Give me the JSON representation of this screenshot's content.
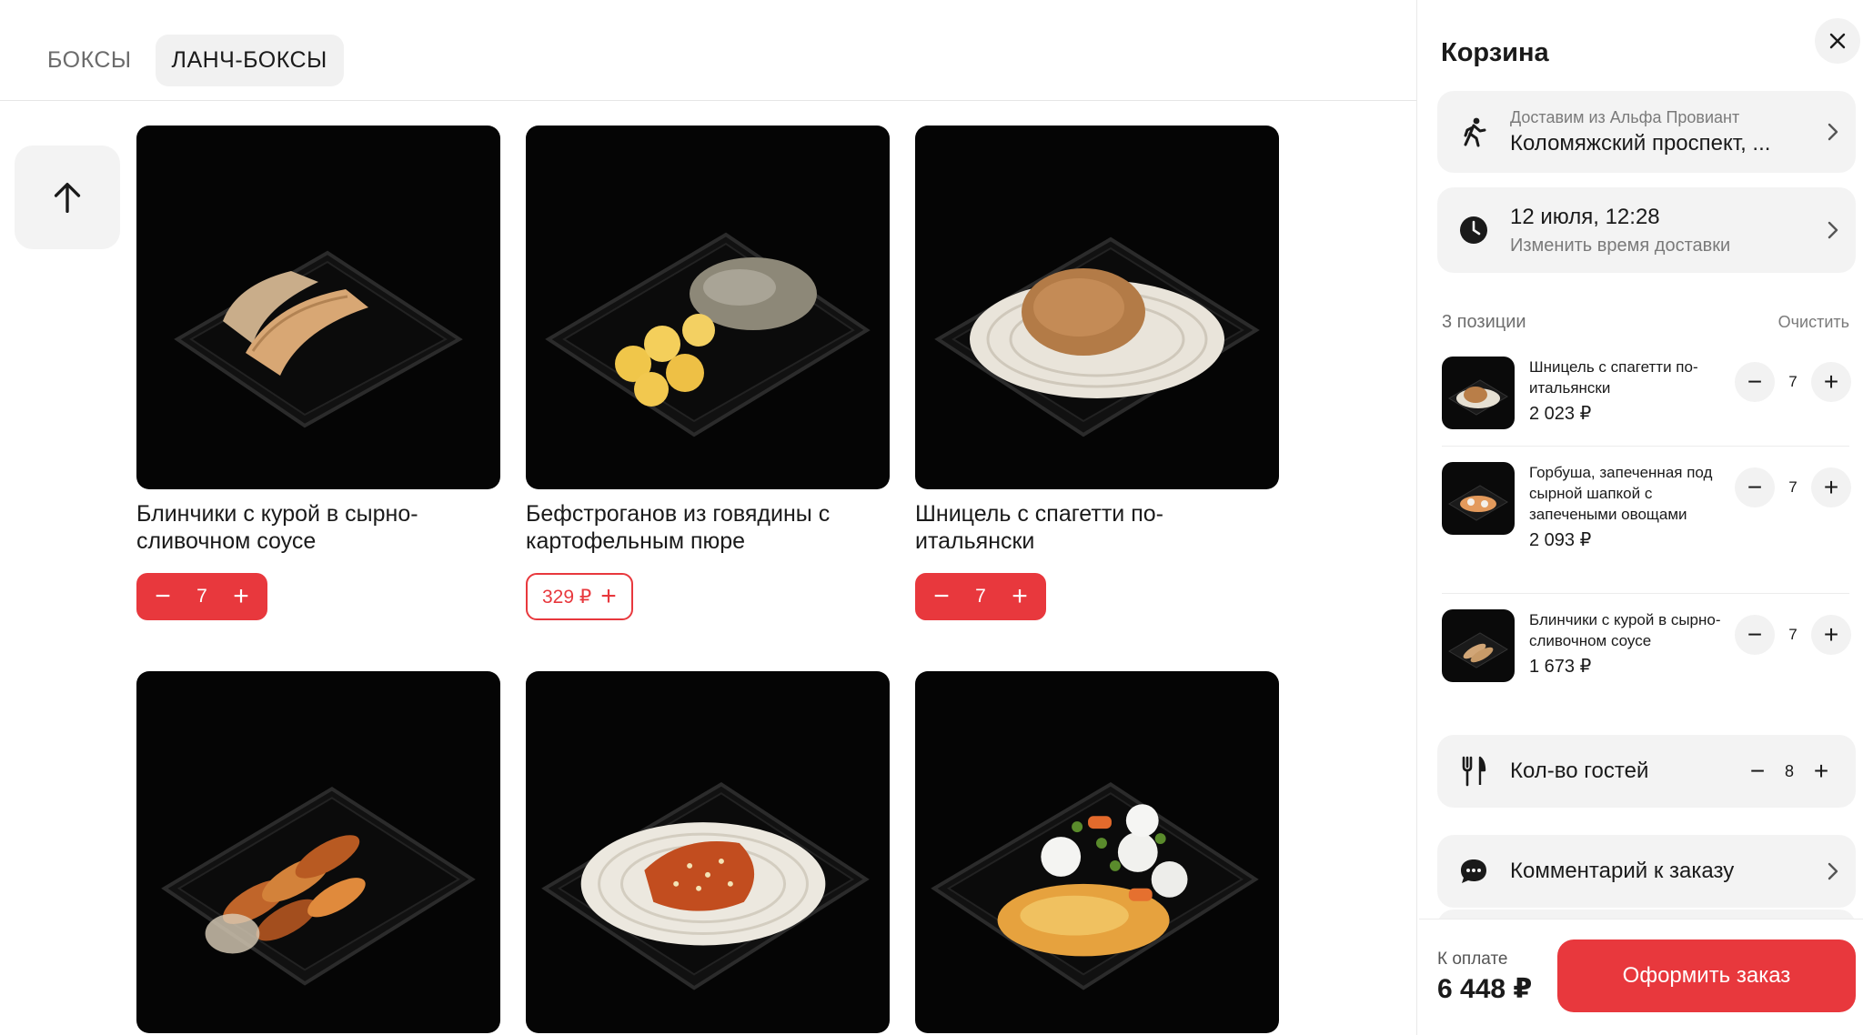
{
  "tabs": [
    {
      "label": "БОКСЫ",
      "active": false
    },
    {
      "label": "ЛАНЧ-БОКСЫ",
      "active": true
    }
  ],
  "products": [
    {
      "name": "Блинчики с курой в сырно-сливочном соусе",
      "qty": "7",
      "food": "crepes"
    },
    {
      "name": "Бефстроганов из говядины с картофельным пюре",
      "price": "329 ₽",
      "food": "stroganoff"
    },
    {
      "name": "Шницель с спагетти по-итальянски",
      "qty": "7",
      "food": "schnitzel"
    },
    {
      "name": "",
      "food": "potatoes"
    },
    {
      "name": "",
      "food": "noodles"
    },
    {
      "name": "",
      "food": "vegetables"
    }
  ],
  "cart": {
    "title": "Корзина",
    "delivery": {
      "label": "Доставим из Альфа Провиант",
      "address": "Коломяжский проспект, ..."
    },
    "time": {
      "value": "12 июля, 12:28",
      "change_label": "Изменить время доставки"
    },
    "positions_label": "3 позиции",
    "clear_label": "Очистить",
    "items": [
      {
        "name": "Шницель с спагетти по-итальянски",
        "price": "2 023 ₽",
        "qty": "7"
      },
      {
        "name": "Горбуша, запеченная под сырной шапкой с запечеными овощами",
        "price": "2 093 ₽",
        "qty": "7"
      },
      {
        "name": "Блинчики с курой в сырно-сливочном соусе",
        "price": "1 673 ₽",
        "qty": "7"
      }
    ],
    "guests": {
      "label": "Кол-во гостей",
      "value": "8"
    },
    "comment_label": "Комментарий к заказу",
    "pay_label": "К оплате",
    "total": "6 448 ₽",
    "order_button": "Оформить заказ"
  },
  "colors": {
    "accent": "#e8383d",
    "panel": "#f3f3f3"
  },
  "icons": [
    "arrow-up-icon",
    "close-icon",
    "walking-person-icon",
    "clock-icon",
    "chevron-right-icon",
    "cutlery-icon",
    "chat-bubble-icon",
    "minus-icon",
    "plus-icon"
  ]
}
